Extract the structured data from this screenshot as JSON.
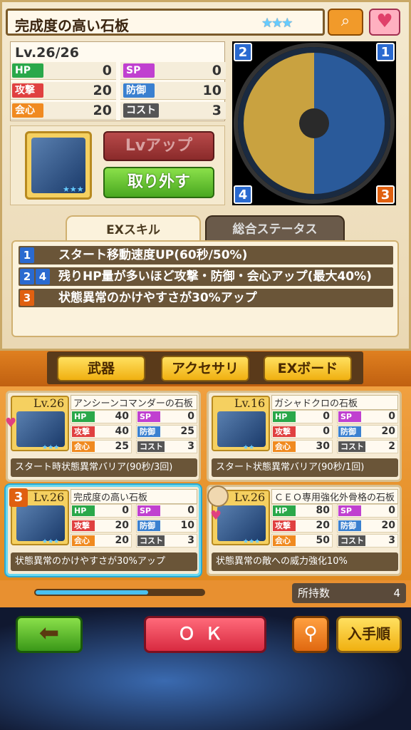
{
  "item": {
    "name": "完成度の高い石板",
    "stars": "★★★",
    "level": "Lv.26/26",
    "stats": [
      {
        "label": "HP",
        "value": "0",
        "color": "#2aa84a"
      },
      {
        "label": "SP",
        "value": "0",
        "color": "#c040d0"
      },
      {
        "label": "攻撃",
        "value": "20",
        "color": "#e04040"
      },
      {
        "label": "防御",
        "value": "10",
        "color": "#3a80d0"
      },
      {
        "label": "会心",
        "value": "20",
        "color": "#f08a20"
      },
      {
        "label": "コスト",
        "value": "3",
        "color": "#555555"
      }
    ]
  },
  "buttons": {
    "lvup": "Lvアップ",
    "remove": "取り外す",
    "ok": "ＯＫ",
    "sort": "入手順",
    "back": "⬅",
    "search": "🔍"
  },
  "board": {
    "corners": [
      "2",
      "1",
      "4",
      "3"
    ]
  },
  "tabs": [
    "EXスキル",
    "総合ステータス"
  ],
  "skills": [
    {
      "nums": [
        "1"
      ],
      "text": "スタート移動速度UP(60秒/50%)"
    },
    {
      "nums": [
        "2",
        "4"
      ],
      "text": "残りHP量が多いほど攻撃・防御・会心アップ(最大40%)"
    },
    {
      "nums": [
        "3"
      ],
      "text": "状態異常のかけやすさが30%アップ"
    }
  ],
  "categories": [
    "武器",
    "アクセサリ",
    "EXボード"
  ],
  "cards": [
    {
      "lv": "Lv.26",
      "name": "アンシーンコマンダーの石板",
      "stars": "★★★",
      "hp": "40",
      "sp": "0",
      "atk": "40",
      "def": "25",
      "crit": "25",
      "cost": "3",
      "desc": "スタート時状態異常バリア(90秒/3回)",
      "badge": ""
    },
    {
      "lv": "Lv.16",
      "name": "ガシャドクロの石板",
      "stars": "★★",
      "hp": "0",
      "sp": "0",
      "atk": "0",
      "def": "20",
      "crit": "30",
      "cost": "2",
      "desc": "スタート状態異常バリア(90秒/1回)",
      "badge": ""
    },
    {
      "lv": "Lv.26",
      "name": "完成度の高い石板",
      "stars": "★★★",
      "hp": "0",
      "sp": "0",
      "atk": "20",
      "def": "10",
      "crit": "20",
      "cost": "3",
      "desc": "状態異常のかけやすさが30%アップ",
      "badge": "3"
    },
    {
      "lv": "Lv.26",
      "name": "ＣＥＯ専用強化外骨格の石板",
      "stars": "★★★",
      "hp": "80",
      "sp": "0",
      "atk": "20",
      "def": "20",
      "crit": "50",
      "cost": "3",
      "desc": "状態異常の敵への威力強化10%",
      "badge": ""
    }
  ],
  "card_labels": {
    "hp": "HP",
    "sp": "SP",
    "atk": "攻撃",
    "def": "防御",
    "crit": "会心",
    "cost": "コスト"
  },
  "owned": {
    "label": "所持数",
    "value": "4"
  },
  "scroll_progress": 0.67
}
